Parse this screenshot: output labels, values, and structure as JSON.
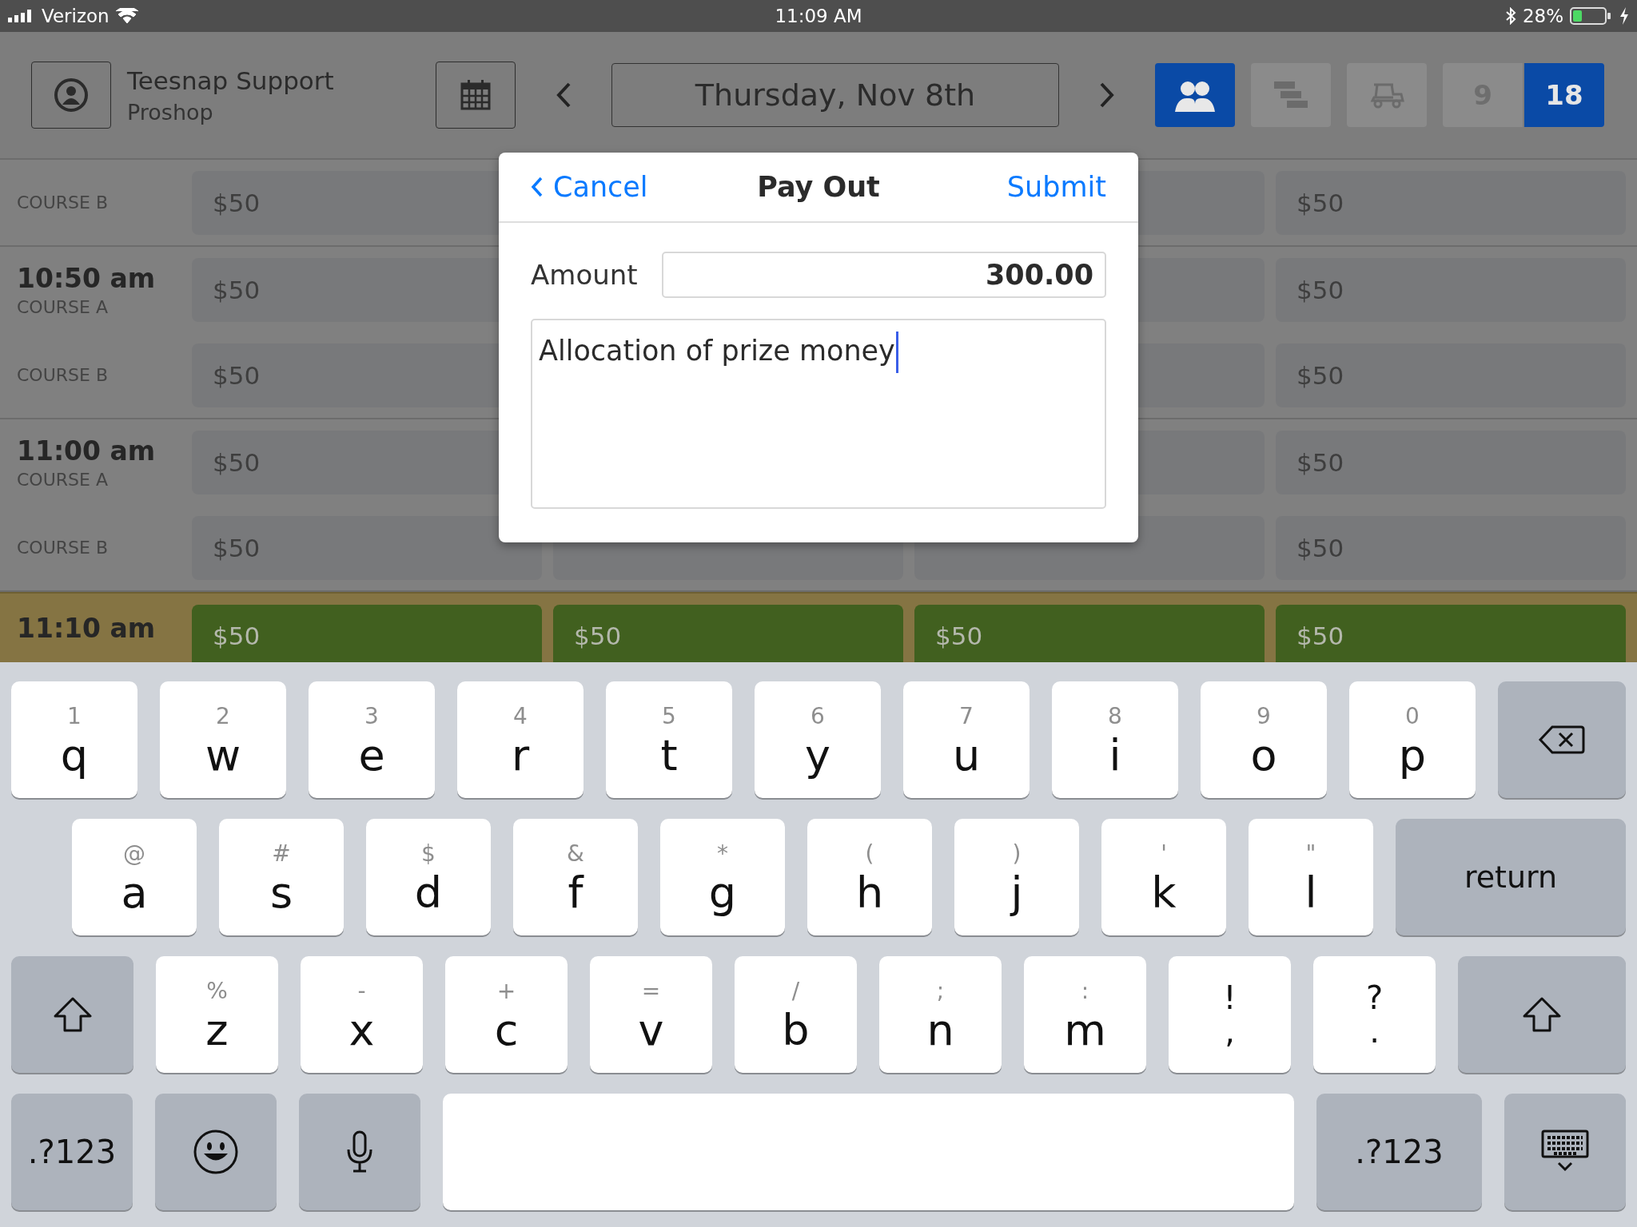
{
  "status_bar": {
    "carrier": "Verizon",
    "time": "11:09 AM",
    "battery": "28%"
  },
  "header": {
    "user": {
      "name": "Teesnap Support",
      "role": "Proshop"
    },
    "date": "Thursday, Nov 8th",
    "views": [
      {
        "kind": "players",
        "selected": true
      },
      {
        "kind": "tee-sheet",
        "selected": false
      },
      {
        "kind": "cart",
        "selected": false
      }
    ],
    "holes": [
      {
        "label": "9",
        "selected": false
      },
      {
        "label": "18",
        "selected": true
      }
    ]
  },
  "slots": [
    {
      "highlighted": false,
      "courses": [
        {
          "course": "COURSE B",
          "cells": [
            {
              "price": "$50"
            },
            {},
            {
              "price": "$50"
            }
          ]
        }
      ]
    },
    {
      "time": "10:50 am",
      "highlighted": false,
      "courses": [
        {
          "course": "COURSE A",
          "cells": [
            {
              "price": "$50"
            },
            {},
            {
              "price": "$50"
            }
          ]
        },
        {
          "course": "COURSE B",
          "cells": [
            {
              "price": "$50"
            },
            {},
            {
              "price": "$50"
            }
          ]
        }
      ]
    },
    {
      "time": "11:00 am",
      "highlighted": false,
      "courses": [
        {
          "course": "COURSE A",
          "cells": [
            {
              "price": "$50"
            },
            {},
            {
              "price": "$50"
            }
          ]
        },
        {
          "course": "COURSE B",
          "cells": [
            {
              "price": "$50"
            },
            {},
            {},
            {
              "price": "$50"
            }
          ]
        }
      ]
    },
    {
      "time": "11:10 am",
      "highlighted": true,
      "courses": [
        {
          "cells": [
            {
              "price": "$50"
            },
            {
              "price": "$50"
            },
            {
              "price": "$50"
            },
            {
              "price": "$50"
            }
          ]
        }
      ]
    }
  ],
  "dialog": {
    "cancel": "Cancel",
    "title": "Pay Out",
    "submit": "Submit",
    "amount": {
      "label": "Amount",
      "value": "300.00"
    },
    "note": {
      "value": "Allocation of prize money",
      "focused": true
    }
  },
  "keyboard": {
    "rows": [
      {
        "keys": [
          {
            "kind": "char",
            "hint": "1",
            "label": "q"
          },
          {
            "kind": "char",
            "hint": "2",
            "label": "w"
          },
          {
            "kind": "char",
            "hint": "3",
            "label": "e"
          },
          {
            "kind": "char",
            "hint": "4",
            "label": "r"
          },
          {
            "kind": "char",
            "hint": "5",
            "label": "t"
          },
          {
            "kind": "char",
            "hint": "6",
            "label": "y"
          },
          {
            "kind": "char",
            "hint": "7",
            "label": "u"
          },
          {
            "kind": "char",
            "hint": "8",
            "label": "i"
          },
          {
            "kind": "char",
            "hint": "9",
            "label": "o"
          },
          {
            "kind": "char",
            "hint": "0",
            "label": "p"
          },
          {
            "kind": "delete"
          }
        ]
      },
      {
        "keys": [
          {
            "kind": "char",
            "hint": "@",
            "label": "a"
          },
          {
            "kind": "char",
            "hint": "#",
            "label": "s"
          },
          {
            "kind": "char",
            "hint": "$",
            "label": "d"
          },
          {
            "kind": "char",
            "hint": "&",
            "label": "f"
          },
          {
            "kind": "char",
            "hint": "*",
            "label": "g"
          },
          {
            "kind": "char",
            "hint": "(",
            "label": "h"
          },
          {
            "kind": "char",
            "hint": ")",
            "label": "j"
          },
          {
            "kind": "char",
            "hint": "'",
            "label": "k"
          },
          {
            "kind": "char",
            "hint": "\"",
            "label": "l"
          },
          {
            "kind": "return",
            "label": "return"
          }
        ]
      },
      {
        "keys": [
          {
            "kind": "shift"
          },
          {
            "kind": "char",
            "hint": "%",
            "label": "z"
          },
          {
            "kind": "char",
            "hint": "-",
            "label": "x"
          },
          {
            "kind": "char",
            "hint": "+",
            "label": "c"
          },
          {
            "kind": "char",
            "hint": "=",
            "label": "v"
          },
          {
            "kind": "char",
            "hint": "/",
            "label": "b"
          },
          {
            "kind": "char",
            "hint": ";",
            "label": "n"
          },
          {
            "kind": "char",
            "hint": ":",
            "label": "m"
          },
          {
            "kind": "punct",
            "top": "!",
            "bottom": ","
          },
          {
            "kind": "punct",
            "top": "?",
            "bottom": "."
          },
          {
            "kind": "shift"
          }
        ]
      },
      {
        "keys": [
          {
            "kind": "numbers",
            "label": ".?123"
          },
          {
            "kind": "emoji"
          },
          {
            "kind": "mic"
          },
          {
            "kind": "space"
          },
          {
            "kind": "numbers",
            "label": ".?123"
          },
          {
            "kind": "dismiss"
          }
        ]
      }
    ]
  }
}
